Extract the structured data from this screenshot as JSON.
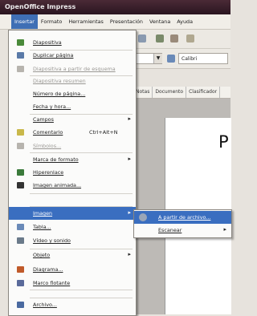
{
  "window": {
    "title": "OpenOffice Impress"
  },
  "menubar": {
    "items": [
      {
        "label": "Insertar"
      },
      {
        "label": "Formato"
      },
      {
        "label": "Herramientas"
      },
      {
        "label": "Presentación"
      },
      {
        "label": "Ventana"
      },
      {
        "label": "Ayuda"
      }
    ]
  },
  "toolbar": {
    "font_name": "Calibri"
  },
  "view_tabs": [
    "Notas",
    "Documento",
    "Clasificador"
  ],
  "slide": {
    "title_fragment": "P"
  },
  "insert_menu": {
    "items": [
      {
        "label": "Diapositiva",
        "icon": "new-slide-icon",
        "color": "#4a8a3a",
        "shortcut": "",
        "state": "normal"
      },
      {
        "label": "Duplicar página",
        "icon": "duplicate-page-icon",
        "color": "#5a7aa8",
        "shortcut": "",
        "state": "normal"
      },
      {
        "label": "Diapositiva a partir de esquema",
        "icon": "outline-slide-icon",
        "color": "#b7b4ae",
        "shortcut": "",
        "state": "disabled"
      },
      {
        "label": "Diapositiva resumen",
        "icon": "",
        "color": "",
        "shortcut": "",
        "state": "disabled"
      },
      {
        "label": "Número de página...",
        "icon": "",
        "color": "",
        "shortcut": "",
        "state": "normal"
      },
      {
        "label": "Fecha y hora...",
        "icon": "",
        "color": "",
        "shortcut": "",
        "state": "normal"
      },
      {
        "label": "Campos",
        "icon": "",
        "color": "",
        "shortcut": "",
        "state": "submenu"
      },
      {
        "label": "Comentario",
        "icon": "comment-icon",
        "color": "#c9b84a",
        "shortcut": "Ctrl+Alt+N",
        "state": "normal"
      },
      {
        "label": "Símbolos...",
        "icon": "symbol-icon",
        "color": "#b7b4ae",
        "shortcut": "",
        "state": "disabled"
      },
      {
        "label": "Marca de formato",
        "icon": "",
        "color": "",
        "shortcut": "",
        "state": "submenu"
      },
      {
        "label": "Hiperenlace",
        "icon": "hyperlink-icon",
        "color": "#3a7a3a",
        "shortcut": "",
        "state": "normal"
      },
      {
        "label": "Imagen animada...",
        "icon": "animated-image-icon",
        "color": "#333333",
        "shortcut": "",
        "state": "normal"
      },
      {
        "label": "Imagen",
        "icon": "",
        "color": "",
        "shortcut": "",
        "state": "highlighted"
      },
      {
        "label": "Tabla...",
        "icon": "table-icon",
        "color": "#6a8ab8",
        "shortcut": "",
        "state": "normal"
      },
      {
        "label": "Vídeo y sonido",
        "icon": "video-sound-icon",
        "color": "#6a7a8a",
        "shortcut": "",
        "state": "normal"
      },
      {
        "label": "Objeto",
        "icon": "",
        "color": "",
        "shortcut": "",
        "state": "submenu"
      },
      {
        "label": "Diagrama...",
        "icon": "chart-icon",
        "color": "#c05a2a",
        "shortcut": "",
        "state": "normal"
      },
      {
        "label": "Marco flotante",
        "icon": "floating-frame-icon",
        "color": "#5a6a9a",
        "shortcut": "",
        "state": "normal"
      },
      {
        "label": "Archivo...",
        "icon": "file-icon",
        "color": "#4a6aa0",
        "shortcut": "",
        "state": "normal"
      }
    ]
  },
  "image_submenu": {
    "items": [
      {
        "label": "A partir de archivo...",
        "icon": "image-file-icon",
        "color": "#9aa6b8",
        "state": "highlighted"
      },
      {
        "label": "Escanear",
        "icon": "",
        "color": "",
        "state": "submenu"
      }
    ]
  },
  "colors": {
    "highlight": "#3a6ec0",
    "titlebar": "#3a1f2b"
  }
}
